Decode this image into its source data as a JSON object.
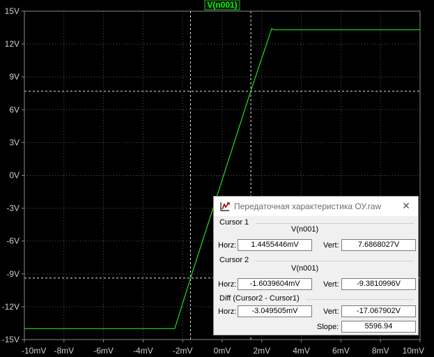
{
  "chart_data": {
    "type": "line",
    "title": "V(n001)",
    "xlabel": "",
    "ylabel": "",
    "xlim": [
      -10,
      10
    ],
    "ylim": [
      -15,
      15
    ],
    "x_unit": "mV",
    "y_unit": "V",
    "x_ticks": [
      -10,
      -8,
      -6,
      -4,
      -2,
      0,
      2,
      4,
      6,
      8,
      10
    ],
    "y_ticks": [
      15,
      12,
      9,
      6,
      3,
      0,
      -3,
      -6,
      -9,
      -12,
      -15
    ],
    "x_tick_labels": [
      "-10mV",
      "-8mV",
      "-6mV",
      "-4mV",
      "-2mV",
      "0mV",
      "2mV",
      "4mV",
      "6mV",
      "8mV",
      "10mV"
    ],
    "y_tick_labels": [
      "15V",
      "12V",
      "9V",
      "6V",
      "3V",
      "0V",
      "-3V",
      "-6V",
      "-9V",
      "-12V",
      "-15V"
    ],
    "grid": true,
    "series": [
      {
        "name": "V(n001)",
        "color": "#22dd22",
        "x": [
          -10,
          -2.4,
          -1.6,
          0.0,
          1.44,
          2.5,
          2.6,
          10
        ],
        "y": [
          -14.0,
          -14.0,
          -9.38,
          -0.4,
          7.69,
          13.4,
          13.3,
          13.3
        ]
      }
    ],
    "cursors": [
      {
        "x": 1.4455446,
        "y": 7.6868027
      },
      {
        "x": -1.6039604,
        "y": -9.3810996
      }
    ],
    "colors": {
      "background": "#000000",
      "grid": "#5a5a5a",
      "cursor": "#e8e8e8",
      "title_label": "#00ff00"
    }
  },
  "cursor_window": {
    "title": "Передаточная характеристика ОУ.raw",
    "close_icon": "✕",
    "cursor1": {
      "label": "Cursor 1",
      "trace": "V(n001)",
      "horz_label": "Horz:",
      "horz_value": "1.4455446mV",
      "vert_label": "Vert:",
      "vert_value": "7.6868027V"
    },
    "cursor2": {
      "label": "Cursor 2",
      "trace": "V(n001)",
      "horz_label": "Horz:",
      "horz_value": "-1.6039604mV",
      "vert_label": "Vert:",
      "vert_value": "-9.3810996V"
    },
    "diff": {
      "label": "Diff (Cursor2 - Cursor1)",
      "horz_label": "Horz:",
      "horz_value": "-3.049505mV",
      "vert_label": "Vert:",
      "vert_value": "-17.067902V",
      "slope_label": "Slope:",
      "slope_value": "5596.94"
    }
  }
}
